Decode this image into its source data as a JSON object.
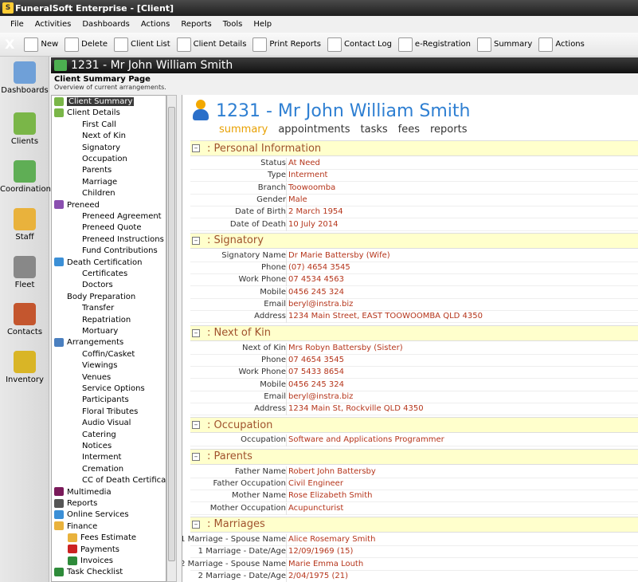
{
  "window": {
    "title": "FuneralSoft Enterprise - [Client]",
    "logo_text": "S"
  },
  "menu": [
    "File",
    "Activities",
    "Dashboards",
    "Actions",
    "Reports",
    "Tools",
    "Help"
  ],
  "toolbar": {
    "close": "X",
    "buttons": [
      {
        "label": "New",
        "icon": "new-icon"
      },
      {
        "label": "Delete",
        "icon": "delete-icon"
      },
      {
        "label": "Client List",
        "icon": "client-list-icon"
      },
      {
        "label": "Client Details",
        "icon": "client-details-icon"
      },
      {
        "label": "Print Reports",
        "icon": "printer-icon"
      },
      {
        "label": "Contact Log",
        "icon": "contact-log-icon"
      },
      {
        "label": "e-Registration",
        "icon": "globe-icon"
      },
      {
        "label": "Summary",
        "icon": "summary-icon"
      },
      {
        "label": "Actions",
        "icon": "actions-icon"
      }
    ]
  },
  "leftnav": [
    {
      "label": "Dashboards",
      "color": "#6fa0d8"
    },
    {
      "label": "Clients",
      "color": "#7ab648"
    },
    {
      "label": "Coordination",
      "color": "#5fae55"
    },
    {
      "label": "Staff",
      "color": "#e9b23c"
    },
    {
      "label": "Fleet",
      "color": "#888888"
    },
    {
      "label": "Contacts",
      "color": "#c4562e"
    },
    {
      "label": "Inventory",
      "color": "#d9b526"
    }
  ],
  "panel": {
    "title": "1231 - Mr John William Smith",
    "subtitle": "Client Summary Page",
    "subtitle_desc": "Overview of current arrangements."
  },
  "tree": [
    {
      "label": "Client Summary",
      "level": 0,
      "icon": "#7ab648",
      "selected": true
    },
    {
      "label": "Client Details",
      "level": 0,
      "icon": "#7ab648"
    },
    {
      "label": "First Call",
      "level": 1
    },
    {
      "label": "Next of Kin",
      "level": 1
    },
    {
      "label": "Signatory",
      "level": 1
    },
    {
      "label": "Occupation",
      "level": 1
    },
    {
      "label": "Parents",
      "level": 1
    },
    {
      "label": "Marriage",
      "level": 1
    },
    {
      "label": "Children",
      "level": 1
    },
    {
      "label": "Preneed",
      "level": 0,
      "icon": "#8a4fb0"
    },
    {
      "label": "Preneed Agreement",
      "level": 1
    },
    {
      "label": "Preneed Quote",
      "level": 1
    },
    {
      "label": "Preneed Instructions",
      "level": 1
    },
    {
      "label": "Fund Contributions",
      "level": 1
    },
    {
      "label": "Death Certification",
      "level": 0,
      "icon": "#3b8fd6"
    },
    {
      "label": "Certificates",
      "level": 1
    },
    {
      "label": "Doctors",
      "level": 1
    },
    {
      "label": "Body Preparation",
      "level": 0,
      "icon": ""
    },
    {
      "label": "Transfer",
      "level": 1
    },
    {
      "label": "Repatriation",
      "level": 1
    },
    {
      "label": "Mortuary",
      "level": 1
    },
    {
      "label": "Arrangements",
      "level": 0,
      "icon": "#4a7fbf"
    },
    {
      "label": "Coffin/Casket",
      "level": 1
    },
    {
      "label": "Viewings",
      "level": 1
    },
    {
      "label": "Venues",
      "level": 1
    },
    {
      "label": "Service Options",
      "level": 1
    },
    {
      "label": "Participants",
      "level": 1
    },
    {
      "label": "Floral Tributes",
      "level": 1
    },
    {
      "label": "Audio Visual",
      "level": 1
    },
    {
      "label": "Catering",
      "level": 1
    },
    {
      "label": "Notices",
      "level": 1
    },
    {
      "label": "Interment",
      "level": 1
    },
    {
      "label": "Cremation",
      "level": 1
    },
    {
      "label": "CC of Death Certificate",
      "level": 1
    },
    {
      "label": "Multimedia",
      "level": 0,
      "icon": "#7a1a5a"
    },
    {
      "label": "Reports",
      "level": 0,
      "icon": "#555555"
    },
    {
      "label": "Online Services",
      "level": 0,
      "icon": "#3b8fd6"
    },
    {
      "label": "Finance",
      "level": 0,
      "icon": "#e9b23c"
    },
    {
      "label": "Fees Estimate",
      "level": 1,
      "icon": "#e9b23c"
    },
    {
      "label": "Payments",
      "level": 1,
      "icon": "#cc2222"
    },
    {
      "label": "Invoices",
      "level": 1,
      "icon": "#2e8b3a"
    },
    {
      "label": "Task Checklist",
      "level": 0,
      "icon": "#2e8b3a"
    }
  ],
  "client": {
    "title": "1231 - Mr John William Smith",
    "tabs": [
      {
        "label": "summary",
        "active": true
      },
      {
        "label": "appointments"
      },
      {
        "label": "tasks"
      },
      {
        "label": "fees"
      },
      {
        "label": "reports"
      }
    ]
  },
  "sections": [
    {
      "title": ": Personal Information",
      "rows": [
        [
          "Status",
          "At Need"
        ],
        [
          "Type",
          "Interment"
        ],
        [
          "Branch",
          "Toowoomba"
        ],
        [
          "Gender",
          "Male"
        ],
        [
          "Date of Birth",
          "2 March 1954"
        ],
        [
          "Date of Death",
          "10 July 2014"
        ]
      ]
    },
    {
      "title": ": Signatory",
      "rows": [
        [
          "Signatory Name",
          "Dr Marie Battersby (Wife)"
        ],
        [
          "Phone",
          "(07) 4654 3545"
        ],
        [
          "Work Phone",
          "07 4534 4563"
        ],
        [
          "Mobile",
          "0456 245 324"
        ],
        [
          "Email",
          "beryl@instra.biz"
        ],
        [
          "Address",
          "1234 Main Street, EAST TOOWOOMBA QLD 4350"
        ]
      ]
    },
    {
      "title": ": Next of Kin",
      "rows": [
        [
          "Next of Kin",
          "Mrs  Robyn  Battersby (Sister)"
        ],
        [
          "Phone",
          "07 4654 3545"
        ],
        [
          "Work Phone",
          "07 5433 8654"
        ],
        [
          "Mobile",
          "0456 245 324"
        ],
        [
          "Email",
          "beryl@instra.biz"
        ],
        [
          "Address",
          "1234 Main St, Rockville QLD 4350"
        ]
      ]
    },
    {
      "title": ": Occupation",
      "rows": [
        [
          "Occupation",
          "Software and Applications Programmer"
        ]
      ]
    },
    {
      "title": ": Parents",
      "rows": [
        [
          "Father Name",
          "Robert John Battersby"
        ],
        [
          "Father Occupation",
          "Civil Engineer"
        ],
        [
          "Mother Name",
          "Rose Elizabeth Smith"
        ],
        [
          "Mother Occupation",
          "Acupuncturist"
        ]
      ]
    },
    {
      "title": ": Marriages",
      "rows": [
        [
          "1 Marriage - Spouse Name",
          "Alice Rosemary Smith"
        ],
        [
          "1 Marriage - Date/Age",
          "12/09/1969 (15)"
        ],
        [
          "2 Marriage - Spouse Name",
          "Marie Emma Louth"
        ],
        [
          "2 Marriage - Date/Age",
          "2/04/1975 (21)"
        ]
      ]
    }
  ]
}
